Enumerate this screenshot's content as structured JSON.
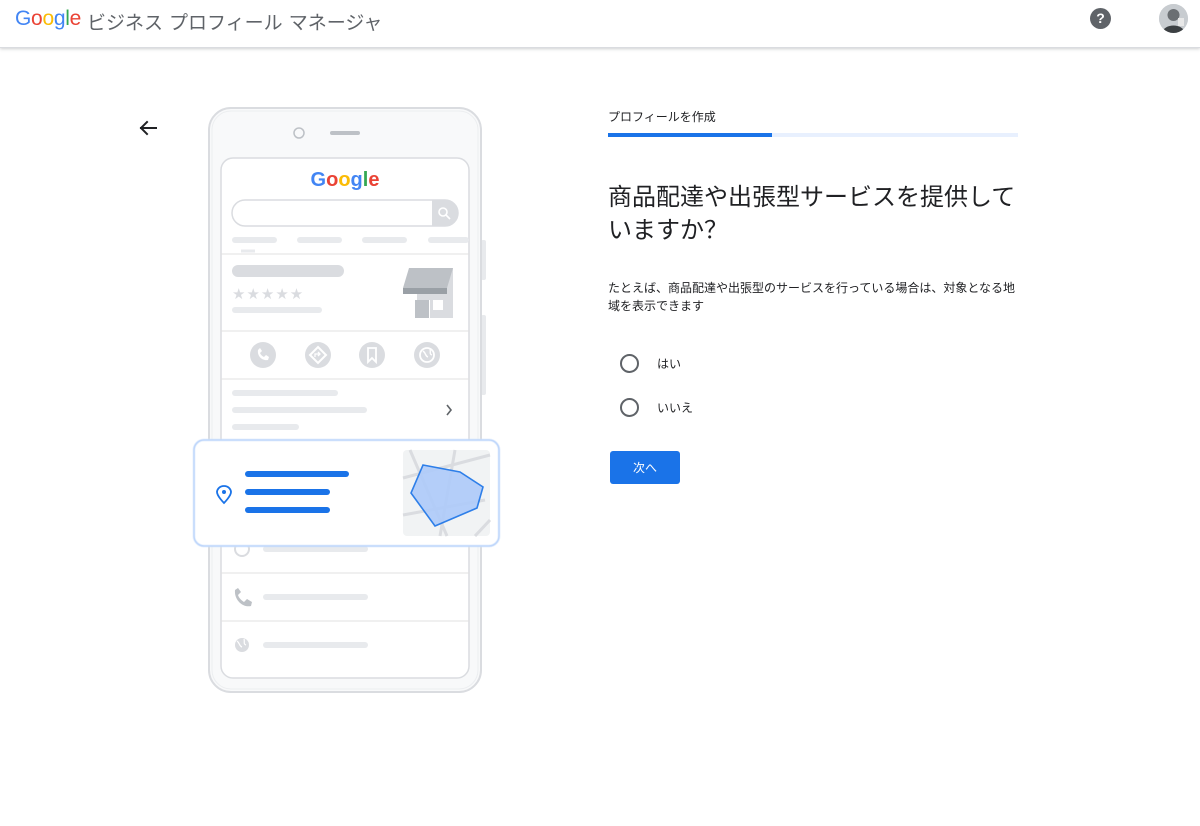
{
  "header": {
    "logo_letters": [
      {
        "ch": "G",
        "color": "#4285F4"
      },
      {
        "ch": "o",
        "color": "#EA4335"
      },
      {
        "ch": "o",
        "color": "#FBBC05"
      },
      {
        "ch": "g",
        "color": "#4285F4"
      },
      {
        "ch": "l",
        "color": "#34A853"
      },
      {
        "ch": "e",
        "color": "#EA4335"
      }
    ],
    "product_name": "ビジネス プロフィール マネージャ",
    "help_glyph": "?",
    "help_icon": "help-icon",
    "avatar_icon": "account-avatar"
  },
  "illustration": {
    "search_logo": "Google",
    "stars": "★★★★★"
  },
  "flow": {
    "step_label": "プロフィールを作成",
    "progress": 0.4,
    "question": "商品配達や出張型サービスを提供していますか？",
    "description": "たとえば、商品配達や出張型のサービスを行っている場合は、対象となる地域を表示できます",
    "options": [
      {
        "label": "はい"
      },
      {
        "label": "いいえ"
      }
    ],
    "next_label": "次へ"
  },
  "colors": {
    "accent": "#1a73e8",
    "progress_track": "#e8f0fe",
    "illustration_gray": "#dadce0"
  }
}
